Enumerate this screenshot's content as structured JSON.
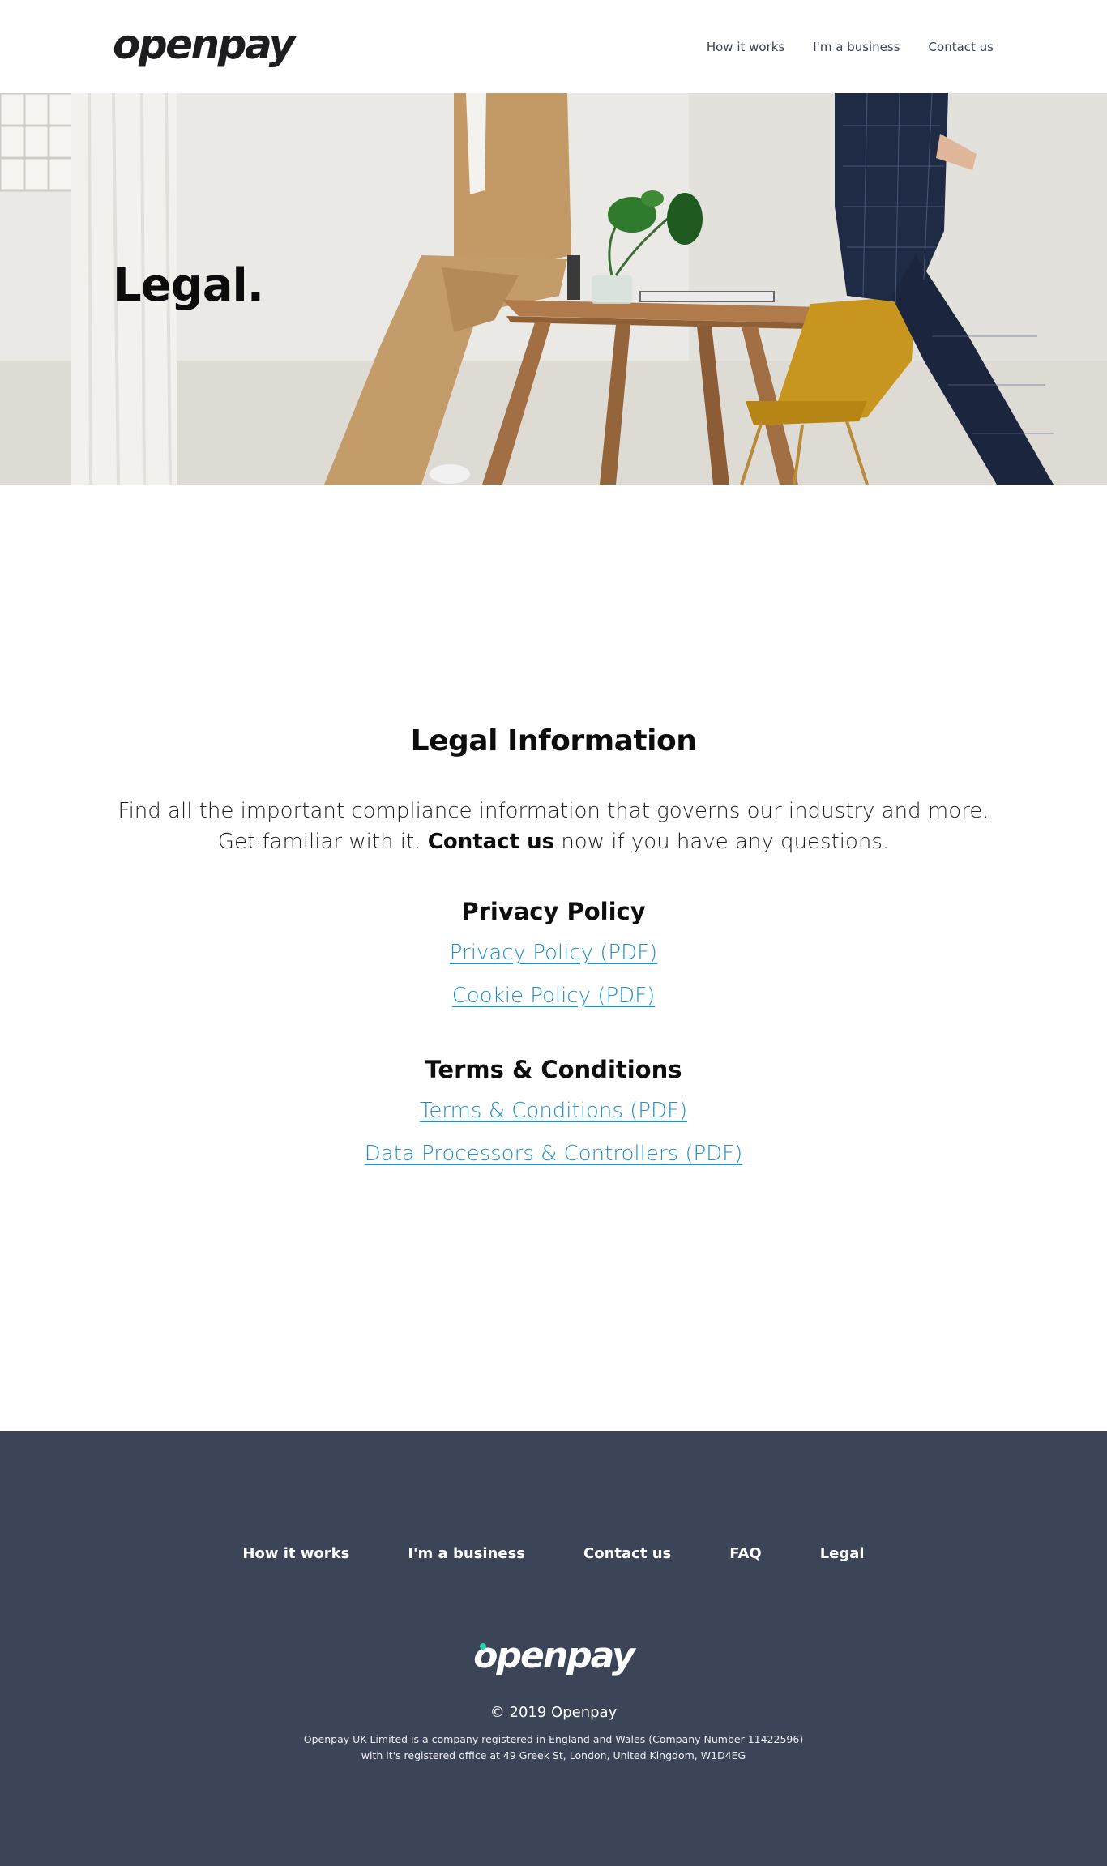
{
  "header": {
    "logo": "openpay",
    "nav": [
      "How it works",
      "I'm a business",
      "Contact us"
    ]
  },
  "hero": {
    "title": "Legal."
  },
  "main": {
    "title": "Legal Information",
    "intro_line1": "Find all the important compliance information that governs our industry and more.",
    "intro_line2_pre": "Get familiar with it.",
    "intro_link": "Contact us",
    "intro_line2_post": "now if you have any questions.",
    "sections": [
      {
        "heading": "Privacy Policy",
        "links": [
          "Privacy Policy (PDF)",
          "Cookie Policy (PDF)"
        ]
      },
      {
        "heading": "Terms & Conditions",
        "links": [
          "Terms & Conditions (PDF)",
          "Data Processors & Controllers (PDF)"
        ]
      }
    ]
  },
  "footer": {
    "nav": [
      "How it works",
      "I'm a business",
      "Contact us",
      "FAQ",
      "Legal"
    ],
    "logo": "openpay",
    "copyright": "© 2019 Openpay",
    "company_line1": "Openpay UK Limited is a company registered in England and Wales (Company Number 11422596)",
    "company_line2": "with it's registered office at 49 Greek St, London, United Kingdom, W1D4EG"
  },
  "colors": {
    "link": "#1f8fc6",
    "footer_bg": "#3c4558",
    "nav_text": "#3a4456",
    "accent_dot": "#2ad0a8"
  }
}
